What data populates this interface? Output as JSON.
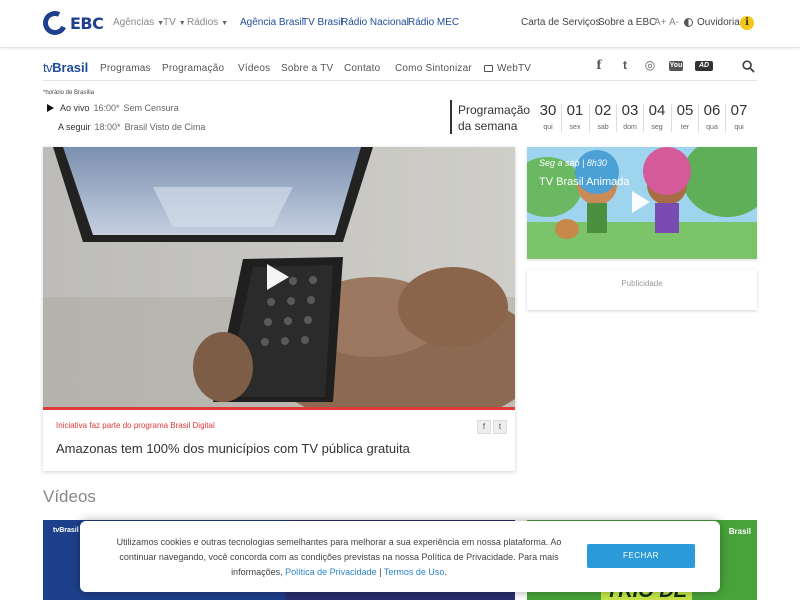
{
  "header": {
    "logo": "EBC",
    "menus": [
      "Agências",
      "TV",
      "Rádios"
    ],
    "brands": [
      "Agência Brasil",
      "TV Brasil",
      "Rádio Nacional",
      "Rádio MEC"
    ],
    "carta": "Carta de Serviços",
    "sobre": "Sobre a EBC",
    "font_up": "A+",
    "font_down": "A-",
    "ouvidoria": "Ouvidoria",
    "info_glyph": "i"
  },
  "nav": {
    "logo_tv": "tv",
    "logo_brasil": "Brasil",
    "items": [
      "Programas",
      "Programação",
      "Vídeos",
      "Sobre a TV",
      "Contato",
      "Como Sintonizar",
      "WebTV"
    ],
    "social_icons": [
      "facebook-icon",
      "twitter-icon",
      "instagram-icon",
      "youtube-icon",
      "audio-description-icon",
      "search-icon"
    ],
    "social_glyphs": [
      "f",
      "t",
      "◎",
      "You",
      "AD"
    ]
  },
  "schedule": {
    "horario": "*horário de Brasília",
    "now_label": "Ao vivo",
    "now_time": "16:00*",
    "now_program": "Sem Censura",
    "next_label": "A seguir",
    "next_time": "18:00*",
    "next_program": "Brasil Visto de Cima",
    "week_label_1": "Programação",
    "week_label_2": "da semana",
    "days": [
      {
        "num": "30",
        "dw": "qui"
      },
      {
        "num": "01",
        "dw": "sex"
      },
      {
        "num": "02",
        "dw": "sab"
      },
      {
        "num": "03",
        "dw": "dom"
      },
      {
        "num": "04",
        "dw": "seg"
      },
      {
        "num": "05",
        "dw": "ter"
      },
      {
        "num": "06",
        "dw": "qua"
      },
      {
        "num": "07",
        "dw": "qui"
      }
    ]
  },
  "feature": {
    "kicker": "Iniciativa faz parte do programa Brasil Digital",
    "title": "Amazonas tem 100% dos municípios com TV pública gratuita",
    "share_fb": "f",
    "share_tw": "t"
  },
  "side": {
    "when": "Seg a sáb | 8h30",
    "title": "TV Brasil Animada",
    "ad": "Publicidade"
  },
  "videos": {
    "heading": "Vídeos",
    "thumb_left_tag": "tvBrasil",
    "thumb_right_tag": "Brasil",
    "thumb_right_text": "TRIO DE"
  },
  "cookie": {
    "text_1": "Utilizamos cookies e outras tecnologias semelhantes para melhorar a sua experiência em nossa plataforma. Ao continuar navegando, você concorda com as condições previstas na nossa Política de Privacidade. Para mais informações,",
    "link_privacy": "Política de Privacidade",
    "separator": "|",
    "link_terms": "Termos de Uso",
    "period": ".",
    "button": "FECHAR"
  }
}
